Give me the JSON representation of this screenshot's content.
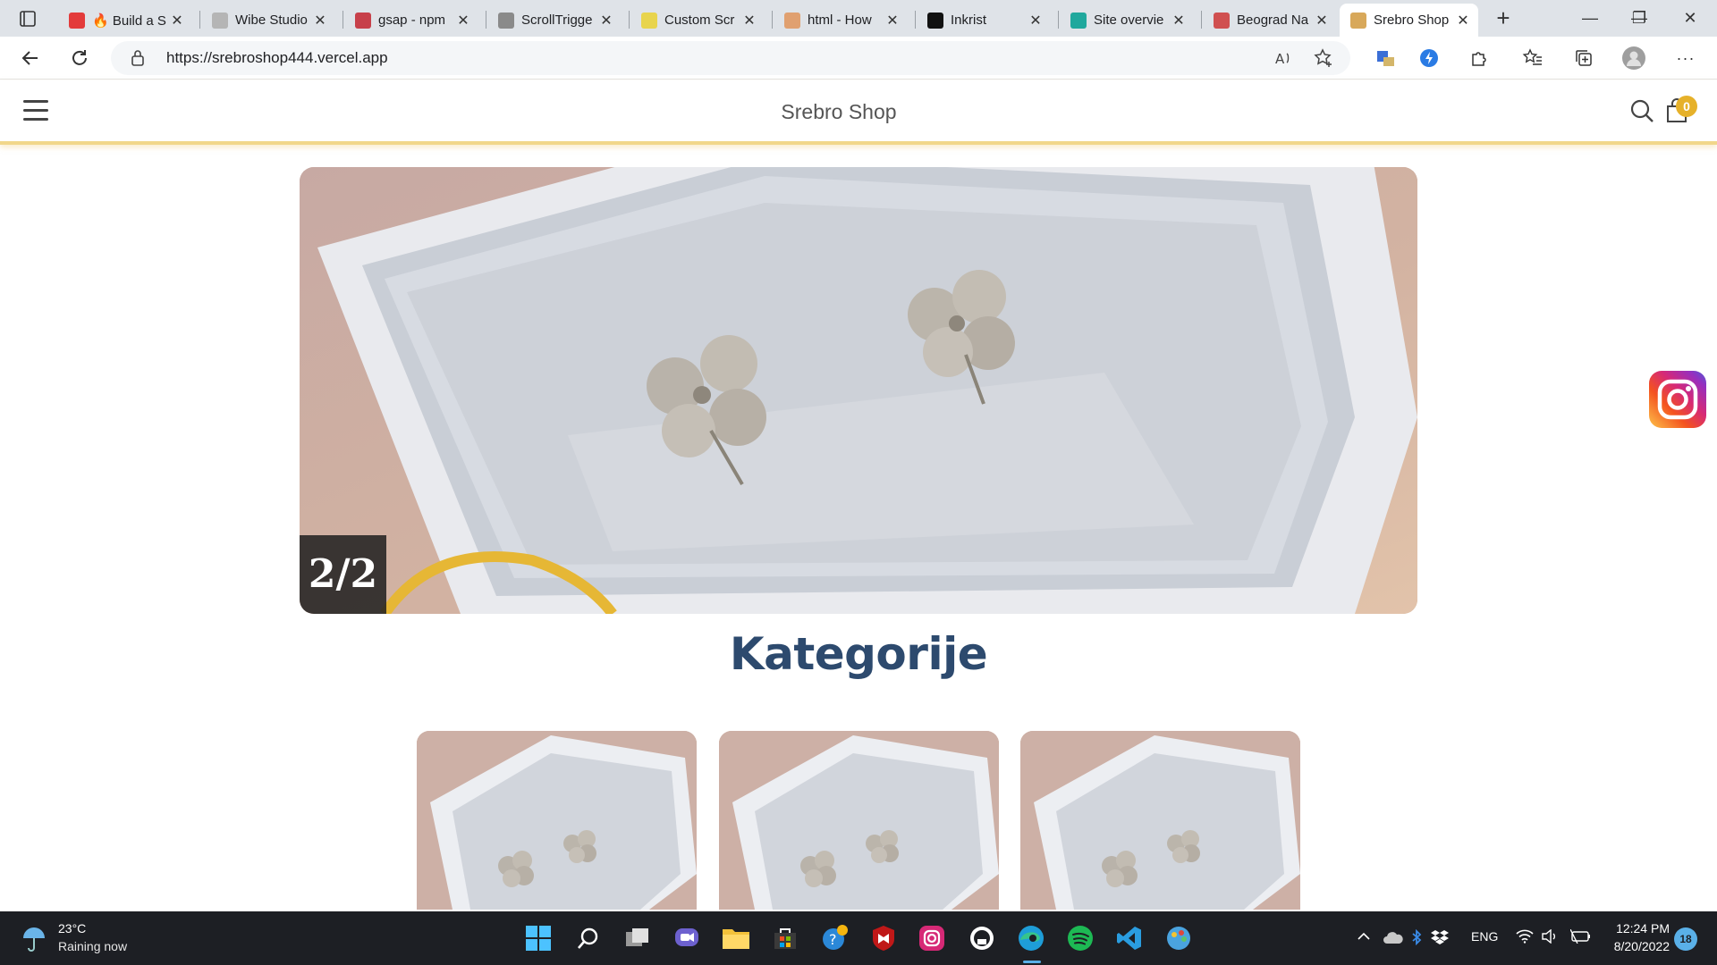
{
  "browser": {
    "tabs": [
      {
        "title": "🔥 Build a S",
        "favicon": "youtube-icon",
        "color": "#e33b3b"
      },
      {
        "title": "Wibe Studio",
        "favicon": "star-icon",
        "color": "#b5b5b5"
      },
      {
        "title": "gsap - npm",
        "favicon": "npm-icon",
        "color": "#c7404a"
      },
      {
        "title": "ScrollTrigge",
        "favicon": "gsap-icon",
        "color": "#8a8a8a"
      },
      {
        "title": "Custom Scr",
        "favicon": "js-icon",
        "color": "#e8d44d"
      },
      {
        "title": "html - How",
        "favicon": "stackoverflow-icon",
        "color": "#e0a070"
      },
      {
        "title": "Inkrist",
        "favicon": "inkrist-icon",
        "color": "#111111"
      },
      {
        "title": "Site overvie",
        "favicon": "netlify-icon",
        "color": "#20a89d"
      },
      {
        "title": "Beograd Na",
        "favicon": "city-icon",
        "color": "#d05050"
      },
      {
        "title": "Srebro Shop",
        "favicon": "shop-icon",
        "color": "#d8a85a",
        "active": true
      }
    ],
    "close_glyph": "✕",
    "newtab_glyph": "+",
    "window_controls": {
      "minimize": "—",
      "restore": "❐",
      "close": "✕"
    },
    "url": "https://srebroshop444.vercel.app",
    "toolbar_more": "···"
  },
  "site": {
    "title": "Srebro Shop",
    "cart_count": "0",
    "accent": "#f1d78a",
    "hero": {
      "counter": "2/2"
    },
    "section_title": "Kategorije",
    "categories": [
      {},
      {},
      {}
    ]
  },
  "taskbar": {
    "weather_temp": "23°C",
    "weather_desc": "Raining now",
    "language": "ENG",
    "time": "12:24 PM",
    "date": "8/20/2022",
    "notifications": "18"
  }
}
